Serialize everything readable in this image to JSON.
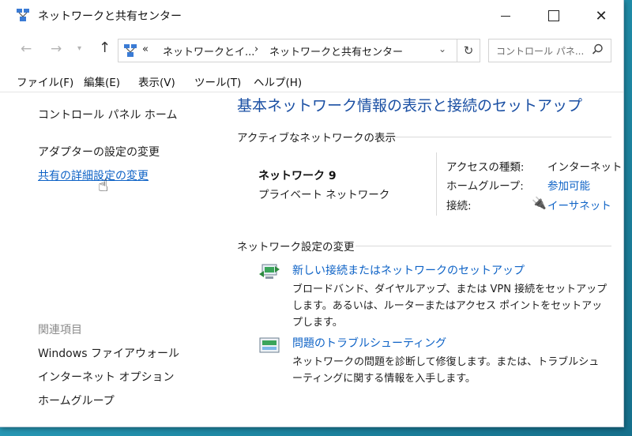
{
  "window": {
    "title": "ネットワークと共有センター"
  },
  "nav": {
    "breadcrumbs": [
      "ネットワークとイ...",
      "ネットワークと共有センター"
    ],
    "overflow_marker": "«",
    "separator": "›",
    "search_placeholder": "コントロール パネ..."
  },
  "menu": {
    "file": "ファイル(F)",
    "edit": "編集(E)",
    "view": "表示(V)",
    "tools": "ツール(T)",
    "help": "ヘルプ(H)"
  },
  "sidebar": {
    "home": "コントロール パネル ホーム",
    "adapter": "アダプターの設定の変更",
    "sharing": "共有の詳細設定の変更",
    "related_heading": "関連項目",
    "related": [
      "Windows ファイアウォール",
      "インターネット オプション",
      "ホームグループ"
    ]
  },
  "main": {
    "title": "基本ネットワーク情報の表示と接続のセットアップ",
    "active_header": "アクティブなネットワークの表示",
    "network": {
      "name": "ネットワーク 9",
      "type": "プライベート ネットワーク",
      "access_label": "アクセスの種類:",
      "access_value": "インターネット",
      "homegroup_label": "ホームグループ:",
      "homegroup_value": "参加可能",
      "connection_label": "接続:",
      "connection_value": "イーサネット"
    },
    "change_header": "ネットワーク設定の変更",
    "tasks": [
      {
        "title": "新しい接続またはネットワークのセットアップ",
        "desc": "ブロードバンド、ダイヤルアップ、または VPN 接続をセットアップします。あるいは、ルーターまたはアクセス ポイントをセットアップします。",
        "icon": "new-connection-icon"
      },
      {
        "title": "問題のトラブルシューティング",
        "desc": "ネットワークの問題を診断して修復します。または、トラブルシューティングに関する情報を入手します。",
        "icon": "troubleshoot-icon"
      }
    ]
  },
  "colors": {
    "link": "#0d62c6",
    "title": "#1a4fa3",
    "desktop": "#1f8aa6"
  }
}
